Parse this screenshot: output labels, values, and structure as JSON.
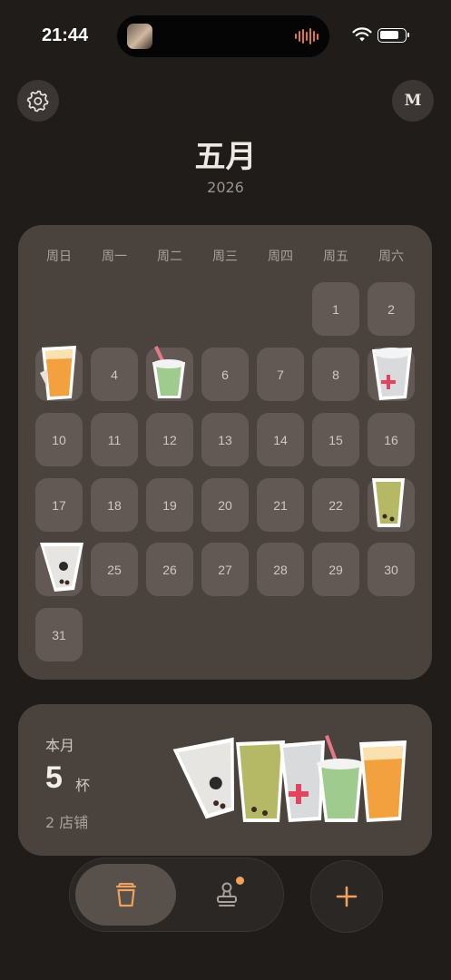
{
  "status_bar": {
    "time": "21:44"
  },
  "header": {
    "profile_initial": "M",
    "month": "五月",
    "year": "2026"
  },
  "calendar": {
    "weekdays": [
      "周日",
      "周一",
      "周二",
      "周三",
      "周四",
      "周五",
      "周六"
    ],
    "days": [
      {
        "day": "1",
        "drink": false
      },
      {
        "day": "2",
        "drink": false
      },
      {
        "day": "3",
        "drink": true,
        "cup": "orange"
      },
      {
        "day": "4",
        "drink": false
      },
      {
        "day": "5",
        "drink": true,
        "cup": "green"
      },
      {
        "day": "6",
        "drink": false
      },
      {
        "day": "7",
        "drink": false
      },
      {
        "day": "8",
        "drink": false
      },
      {
        "day": "9",
        "drink": true,
        "cup": "white"
      },
      {
        "day": "10",
        "drink": false
      },
      {
        "day": "11",
        "drink": false
      },
      {
        "day": "12",
        "drink": false
      },
      {
        "day": "13",
        "drink": false
      },
      {
        "day": "14",
        "drink": false
      },
      {
        "day": "15",
        "drink": false
      },
      {
        "day": "16",
        "drink": false
      },
      {
        "day": "17",
        "drink": false
      },
      {
        "day": "18",
        "drink": false
      },
      {
        "day": "19",
        "drink": false
      },
      {
        "day": "20",
        "drink": false
      },
      {
        "day": "21",
        "drink": false
      },
      {
        "day": "22",
        "drink": false
      },
      {
        "day": "23",
        "drink": true,
        "cup": "matcha"
      },
      {
        "day": "24",
        "drink": true,
        "cup": "milk"
      },
      {
        "day": "25",
        "drink": false
      },
      {
        "day": "26",
        "drink": false
      },
      {
        "day": "27",
        "drink": false
      },
      {
        "day": "28",
        "drink": false
      },
      {
        "day": "29",
        "drink": false
      },
      {
        "day": "30",
        "drink": false
      },
      {
        "day": "31",
        "drink": false
      }
    ]
  },
  "summary": {
    "label": "本月",
    "count": "5",
    "unit": "杯",
    "shops": "2 店铺"
  },
  "colors": {
    "background": "#1f1c1a",
    "card": "#4a423d",
    "day_cell": "#625955",
    "accent": "#f0a25c"
  },
  "icons": {
    "settings": "gear-icon",
    "profile": "avatar",
    "cups_tab": "cup-icon",
    "stamp_tab": "stamp-icon",
    "add": "plus-icon"
  }
}
